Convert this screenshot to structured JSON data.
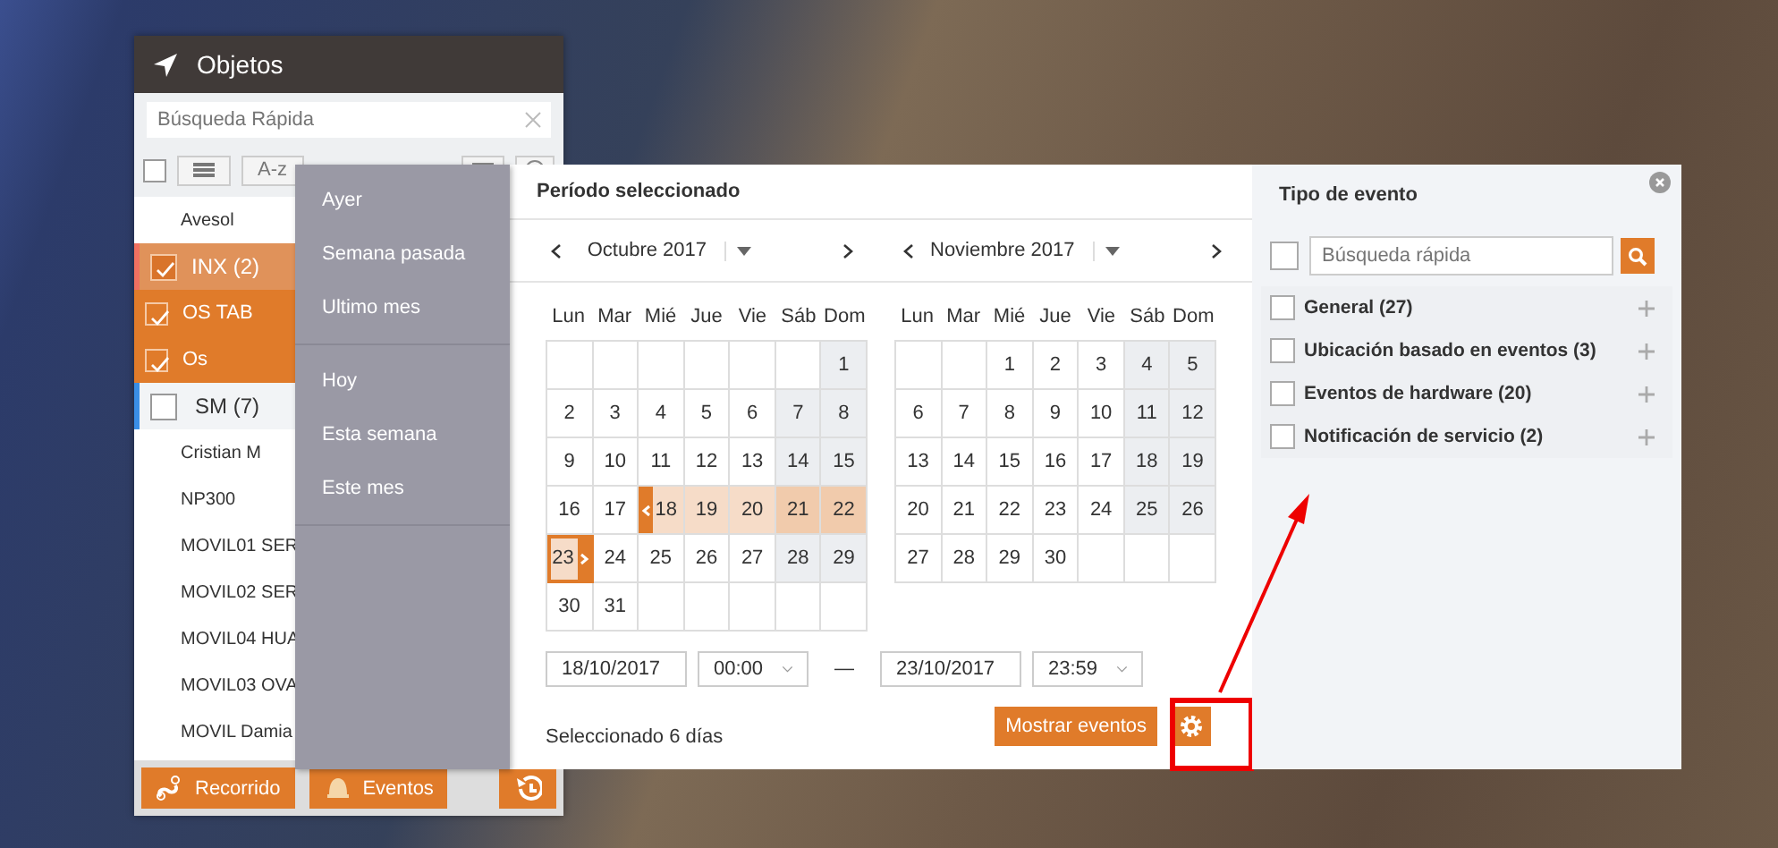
{
  "objects_panel": {
    "title": "Objetos",
    "search": {
      "placeholder": "Búsqueda Rápida"
    },
    "select_all_checked": false,
    "sort_label": "A-z",
    "items": [
      {
        "label": "Avesol",
        "kind": "object",
        "checked": false
      },
      {
        "label": "INX (2)",
        "kind": "group",
        "checked": true
      },
      {
        "label": "OS TAB",
        "kind": "object",
        "checked": true
      },
      {
        "label": "Os",
        "kind": "object",
        "checked": true
      },
      {
        "label": "SM (7)",
        "kind": "group",
        "checked": false
      },
      {
        "label": "Cristian M",
        "kind": "object",
        "checked": false
      },
      {
        "label": "NP300",
        "kind": "object",
        "checked": false
      },
      {
        "label": "MOVIL01 SER",
        "kind": "object",
        "checked": false
      },
      {
        "label": "MOVIL02 SER",
        "kind": "object",
        "checked": false
      },
      {
        "label": "MOVIL04 HUA",
        "kind": "object",
        "checked": false
      },
      {
        "label": "MOVIL03 OVA",
        "kind": "object",
        "checked": false
      },
      {
        "label": "MOVIL Damia",
        "kind": "object",
        "checked": false
      }
    ],
    "buttons": [
      {
        "label": "Recorrido",
        "kind": "route"
      },
      {
        "label": "Eventos",
        "kind": "events"
      },
      {
        "kind": "history"
      }
    ]
  },
  "period_menu": {
    "sections": [
      [
        "Ayer",
        "Semana pasada",
        "Ultimo mes"
      ],
      [
        "Hoy",
        "Esta semana",
        "Este mes"
      ]
    ]
  },
  "period_dialog": {
    "title": "Período seleccionado",
    "months": [
      {
        "label": "Octubre 2017",
        "weekdays": [
          "Lun",
          "Mar",
          "Mié",
          "Jue",
          "Vie",
          "Sáb",
          "Dom"
        ],
        "weeks": [
          [
            {
              "kind": "blank"
            },
            {
              "kind": "blank"
            },
            {
              "kind": "blank"
            },
            {
              "kind": "blank"
            },
            {
              "kind": "blank"
            },
            {
              "kind": "blank"
            },
            {
              "day": "1",
              "kind": "plain"
            }
          ],
          [
            {
              "day": "2",
              "kind": "plain"
            },
            {
              "day": "3",
              "kind": "plain"
            },
            {
              "day": "4",
              "kind": "plain"
            },
            {
              "day": "5",
              "kind": "plain"
            },
            {
              "day": "6",
              "kind": "plain"
            },
            {
              "day": "7",
              "kind": "plain"
            },
            {
              "day": "8",
              "kind": "plain"
            }
          ],
          [
            {
              "day": "9",
              "kind": "plain"
            },
            {
              "day": "10",
              "kind": "plain"
            },
            {
              "day": "11",
              "kind": "plain"
            },
            {
              "day": "12",
              "kind": "plain"
            },
            {
              "day": "13",
              "kind": "plain"
            },
            {
              "day": "14",
              "kind": "plain"
            },
            {
              "day": "15",
              "kind": "plain"
            }
          ],
          [
            {
              "day": "16",
              "kind": "plain"
            },
            {
              "day": "17",
              "kind": "plain"
            },
            {
              "day": "18",
              "kind": "range_start"
            },
            {
              "day": "19",
              "kind": "in_range"
            },
            {
              "day": "20",
              "kind": "in_range"
            },
            {
              "day": "21",
              "kind": "in_range"
            },
            {
              "day": "22",
              "kind": "in_range"
            }
          ],
          [
            {
              "day": "23",
              "kind": "range_end"
            },
            {
              "day": "24",
              "kind": "plain"
            },
            {
              "day": "25",
              "kind": "plain"
            },
            {
              "day": "26",
              "kind": "plain"
            },
            {
              "day": "27",
              "kind": "plain"
            },
            {
              "day": "28",
              "kind": "plain"
            },
            {
              "day": "29",
              "kind": "plain"
            }
          ],
          [
            {
              "day": "30",
              "kind": "plain"
            },
            {
              "day": "31",
              "kind": "plain"
            },
            {
              "kind": "blank"
            },
            {
              "kind": "blank"
            },
            {
              "kind": "blank"
            },
            {
              "kind": "blank"
            },
            {
              "kind": "blank"
            }
          ]
        ]
      },
      {
        "label": "Noviembre 2017",
        "weekdays": [
          "Lun",
          "Mar",
          "Mié",
          "Jue",
          "Vie",
          "Sáb",
          "Dom"
        ],
        "weeks": [
          [
            {
              "kind": "blank"
            },
            {
              "kind": "blank"
            },
            {
              "day": "1",
              "kind": "plain"
            },
            {
              "day": "2",
              "kind": "plain"
            },
            {
              "day": "3",
              "kind": "plain"
            },
            {
              "day": "4",
              "kind": "plain"
            },
            {
              "day": "5",
              "kind": "plain"
            }
          ],
          [
            {
              "day": "6",
              "kind": "plain"
            },
            {
              "day": "7",
              "kind": "plain"
            },
            {
              "day": "8",
              "kind": "plain"
            },
            {
              "day": "9",
              "kind": "plain"
            },
            {
              "day": "10",
              "kind": "plain"
            },
            {
              "day": "11",
              "kind": "plain"
            },
            {
              "day": "12",
              "kind": "plain"
            }
          ],
          [
            {
              "day": "13",
              "kind": "plain"
            },
            {
              "day": "14",
              "kind": "plain"
            },
            {
              "day": "15",
              "kind": "plain"
            },
            {
              "day": "16",
              "kind": "plain"
            },
            {
              "day": "17",
              "kind": "plain"
            },
            {
              "day": "18",
              "kind": "plain"
            },
            {
              "day": "19",
              "kind": "plain"
            }
          ],
          [
            {
              "day": "20",
              "kind": "plain"
            },
            {
              "day": "21",
              "kind": "plain"
            },
            {
              "day": "22",
              "kind": "plain"
            },
            {
              "day": "23",
              "kind": "plain"
            },
            {
              "day": "24",
              "kind": "plain"
            },
            {
              "day": "25",
              "kind": "plain"
            },
            {
              "day": "26",
              "kind": "plain"
            }
          ],
          [
            {
              "day": "27",
              "kind": "plain"
            },
            {
              "day": "28",
              "kind": "plain"
            },
            {
              "day": "29",
              "kind": "plain"
            },
            {
              "day": "30",
              "kind": "plain"
            },
            {
              "kind": "blank"
            },
            {
              "kind": "blank"
            },
            {
              "kind": "blank"
            }
          ]
        ]
      }
    ],
    "start": {
      "date": "18/10/2017",
      "time": "00:00"
    },
    "separator": "—",
    "end": {
      "date": "23/10/2017",
      "time": "23:59"
    },
    "summary": "Seleccionado 6 días",
    "show_button": "Mostrar eventos"
  },
  "event_types": {
    "title": "Tipo de evento",
    "select_all_checked": false,
    "search": {
      "placeholder": "Búsqueda rápida"
    },
    "items": [
      {
        "label": "General (27)",
        "checked": false,
        "expanded": false
      },
      {
        "label": "Ubicación basado en eventos (3)",
        "checked": false,
        "expanded": false
      },
      {
        "label": "Eventos de hardware (20)",
        "checked": false,
        "expanded": false
      },
      {
        "label": "Notificación de servicio (2)",
        "checked": false,
        "expanded": false
      }
    ]
  }
}
